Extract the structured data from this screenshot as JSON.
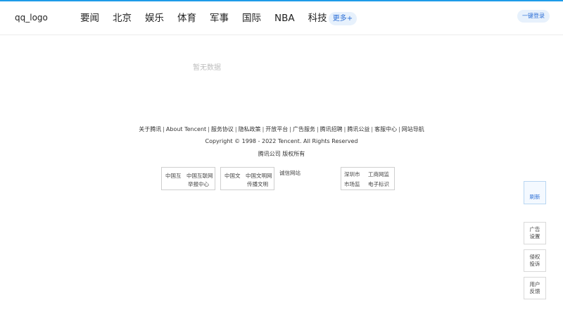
{
  "header": {
    "logo": "qq_logo",
    "nav": [
      "要闻",
      "北京",
      "娱乐",
      "体育",
      "军事",
      "国际",
      "NBA",
      "科技"
    ],
    "more_label": "更多+",
    "login_label": "一键登录"
  },
  "main": {
    "empty_text": "暂无数据"
  },
  "footer": {
    "links": [
      "关于腾讯",
      "About Tencent",
      "服务协议",
      "隐私政策",
      "开放平台",
      "广告服务",
      "腾讯招聘",
      "腾讯公益",
      "客服中心",
      "网站导航"
    ],
    "separator": "|",
    "copyright": "Copyright © 1998 - 2022 Tencent. All Rights Reserved",
    "rights": "腾讯公司 版权所有",
    "badges": {
      "internet_report": {
        "left_line": "中国互",
        "right_line1": "中国互联网",
        "right_line2": "举报中心"
      },
      "civilization": {
        "left_line": "中国文",
        "right_line1": "中国文明网",
        "right_line2": "传播文明"
      },
      "trust": {
        "label": "诚信网站"
      },
      "market": {
        "left_line1": "深圳市",
        "left_line2": "市场监",
        "right_line1": "工商网监",
        "right_line2": "电子标识"
      }
    }
  },
  "sidebar": {
    "refresh": "刷新",
    "ad_settings": [
      "广告",
      "设置"
    ],
    "report": [
      "侵权",
      "投诉"
    ],
    "feedback": [
      "用户",
      "反馈"
    ]
  }
}
